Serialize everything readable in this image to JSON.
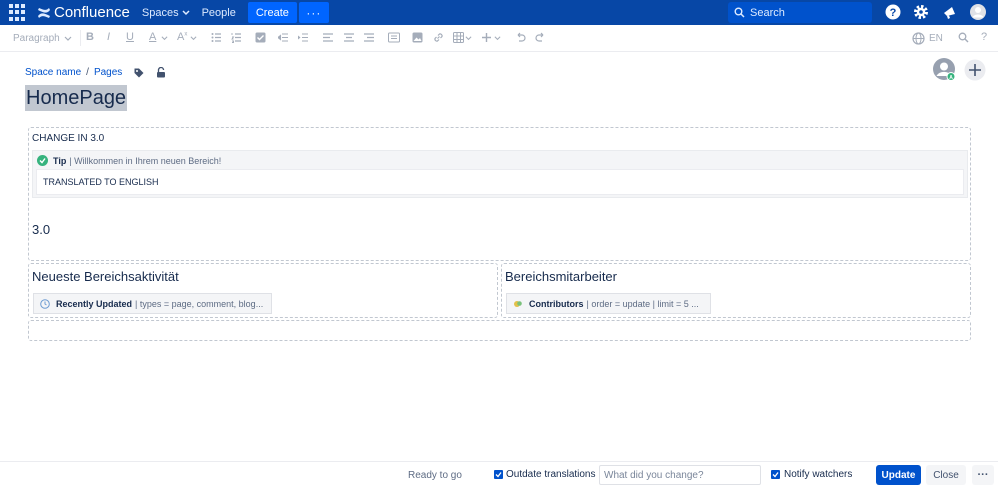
{
  "nav": {
    "product": "Confluence",
    "spaces": "Spaces",
    "people": "People",
    "create": "Create",
    "more": "···",
    "search_placeholder": "Search"
  },
  "toolbar": {
    "paragraph": "Paragraph",
    "language": "EN"
  },
  "breadcrumb": {
    "space": "Space name",
    "separator": "/",
    "pages": "Pages"
  },
  "page": {
    "title": "HomePage",
    "section1": {
      "heading": "CHANGE IN 3.0",
      "tip_label": "Tip",
      "tip_text": "| Willkommen in Ihrem neuen Bereich!",
      "tip_body": "TRANSLATED TO ENGLISH",
      "version": "3.0"
    },
    "left": {
      "heading": "Neueste Bereichsaktivität",
      "macro_label": "Recently Updated",
      "macro_params": "| types = page, comment, blog..."
    },
    "right": {
      "heading": "Bereichsmitarbeiter",
      "macro_label": "Contributors",
      "macro_params": "| order = update | limit = 5 ..."
    }
  },
  "footer": {
    "status": "Ready to go",
    "outdate": "Outdate translations",
    "change_placeholder": "What did you change?",
    "notify": "Notify watchers",
    "update": "Update",
    "close": "Close",
    "more": "···"
  },
  "colors": {
    "nav_bg": "#0747a6",
    "primary": "#0052cc",
    "create": "#0065ff",
    "title_highlight": "#c1c7d0"
  }
}
